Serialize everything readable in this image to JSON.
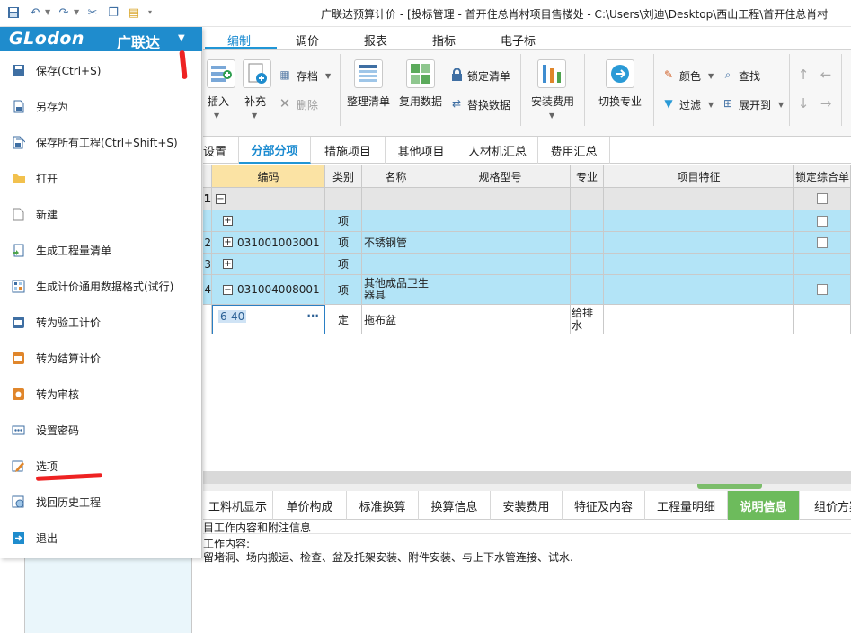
{
  "window": {
    "title": "广联达预算计价 - [投标管理 - 首开住总肖村项目售楼处 - C:\\Users\\刘迪\\Desktop\\西山工程\\首开住总肖村"
  },
  "ribbon_tabs": [
    "编制",
    "调价",
    "报表",
    "指标",
    "电子标"
  ],
  "ribbon": {
    "insert": "插入",
    "supplement": "补充",
    "save_file": "存档",
    "delete": "删除",
    "organize_list": "整理清单",
    "reuse_data": "复用数据",
    "lock_list": "锁定清单",
    "replace_data": "替换数据",
    "install_cost": "安装费用",
    "switch_major": "切换专业",
    "color": "颜色",
    "find": "查找",
    "filter": "过滤",
    "expand_to": "展开到"
  },
  "view_tabs": [
    "设置",
    "分部分项",
    "措施项目",
    "其他项目",
    "人材机汇总",
    "费用汇总"
  ],
  "grid": {
    "columns": [
      "编码",
      "类别",
      "名称",
      "规格型号",
      "专业",
      "项目特征",
      "锁定综合单"
    ],
    "rows": [
      {
        "num": "1",
        "expander": "−",
        "code": "",
        "type": "",
        "name": "",
        "major": ""
      },
      {
        "num": "",
        "expander": "+",
        "code": "",
        "type": "项",
        "name": "",
        "major": ""
      },
      {
        "num": "2",
        "expander": "+",
        "code": "031001003001",
        "type": "项",
        "name": "不锈钢管",
        "major": ""
      },
      {
        "num": "3",
        "expander": "+",
        "code": "",
        "type": "项",
        "name": "",
        "major": ""
      },
      {
        "num": "4",
        "expander": "−",
        "code": "031004008001",
        "type": "项",
        "name": "其他成品卫生器具",
        "major": ""
      },
      {
        "num": "",
        "expander": "",
        "code": "6-40",
        "type": "定",
        "name": "拖布盆",
        "major": "给排水"
      }
    ]
  },
  "bottom_tabs": [
    "工料机显示",
    "单价构成",
    "标准换算",
    "换算信息",
    "安装费用",
    "特征及内容",
    "工程量明细",
    "说明信息",
    "组价方案"
  ],
  "description": {
    "title": "目工作内容和附注信息",
    "label": "工作内容:",
    "text": "留堵洞、场内搬运、检查、盆及托架安装、附件安装、与上下水管连接、试水."
  },
  "menu": {
    "logo": "GLodon",
    "logo_cn": "广联达",
    "items": [
      "保存(Ctrl+S)",
      "另存为",
      "保存所有工程(Ctrl+Shift+S)",
      "打开",
      "新建",
      "生成工程量清单",
      "生成计价通用数据格式(试行)",
      "转为验工计价",
      "转为结算计价",
      "转为审核",
      "设置密码",
      "选项",
      "找回历史工程",
      "退出"
    ]
  },
  "colors": {
    "accent": "#1f8ccd",
    "row_highlight": "#b3e4f7",
    "active_bottom_tab": "#6dbb5c",
    "annotation": "#ee2222"
  }
}
